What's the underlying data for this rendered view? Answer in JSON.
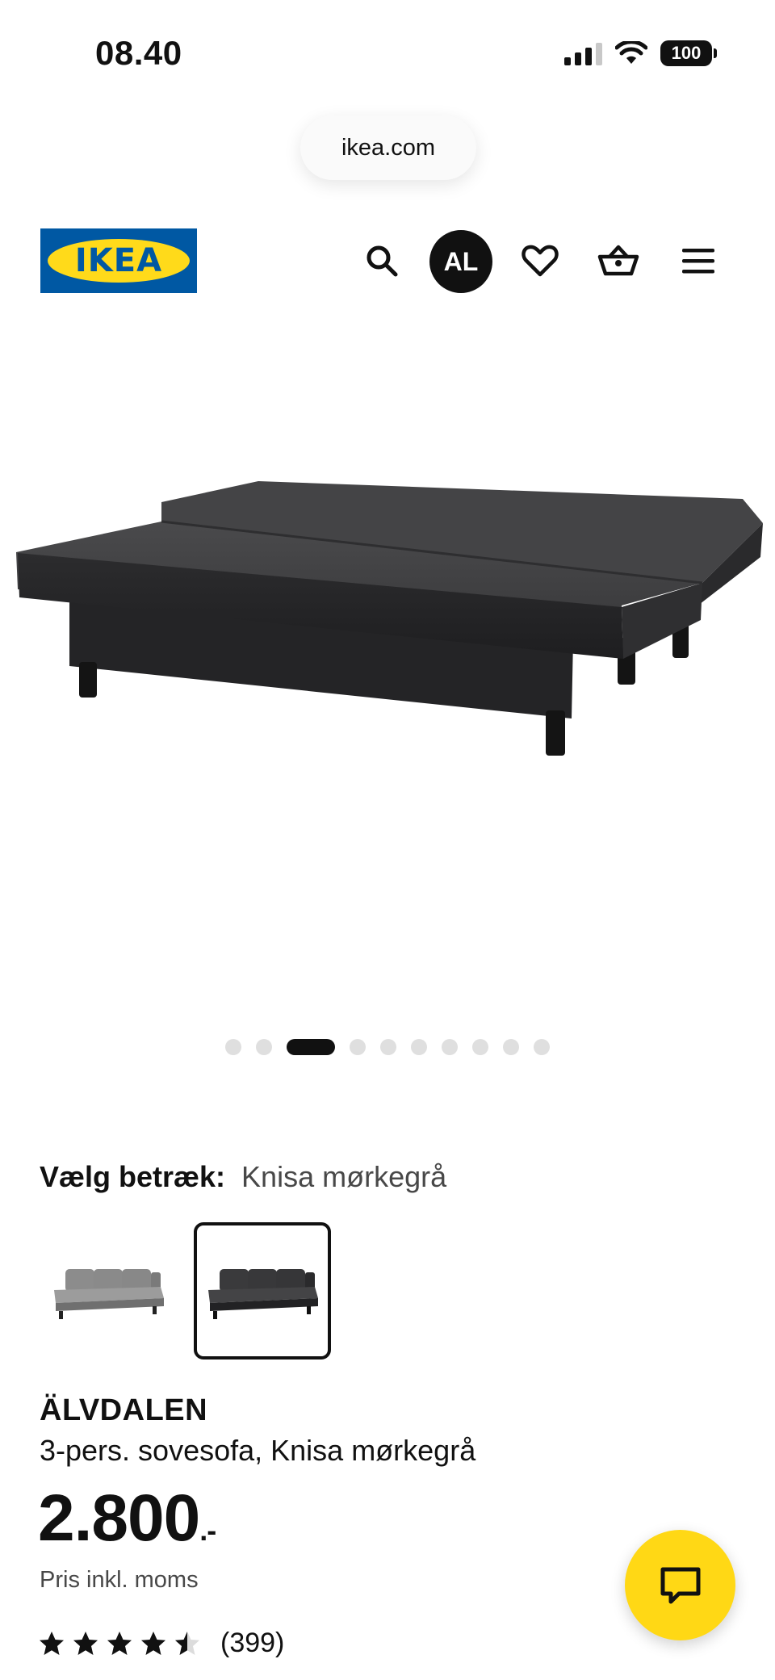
{
  "status_bar": {
    "time": "08.40",
    "battery": "100",
    "icons": [
      "cellular-signal-icon",
      "wifi-icon",
      "battery-icon"
    ]
  },
  "browser": {
    "url": "ikea.com"
  },
  "header": {
    "logo_text": "IKEA",
    "logo_colors": {
      "blue": "#0058a3",
      "yellow": "#ffda1a"
    },
    "avatar_initials": "AL",
    "icons": [
      "search-icon",
      "heart-icon",
      "basket-icon",
      "menu-icon"
    ]
  },
  "gallery": {
    "dot_count": 10,
    "active_index": 2
  },
  "cover": {
    "label": "Vælg betræk:",
    "selected_value": "Knisa mørkegrå",
    "options_count": 2,
    "selected_index": 1
  },
  "product": {
    "name": "ÄLVDALEN",
    "description": "3-pers. sovesofa, Knisa mørkegrå",
    "price": "2.800",
    "price_suffix": ".-",
    "price_note": "Pris inkl. moms",
    "rating": 4.5,
    "rating_max": 5,
    "review_count": "(399)"
  },
  "chat": {
    "icon": "chat-bubble-icon",
    "color": "#ffd815"
  }
}
